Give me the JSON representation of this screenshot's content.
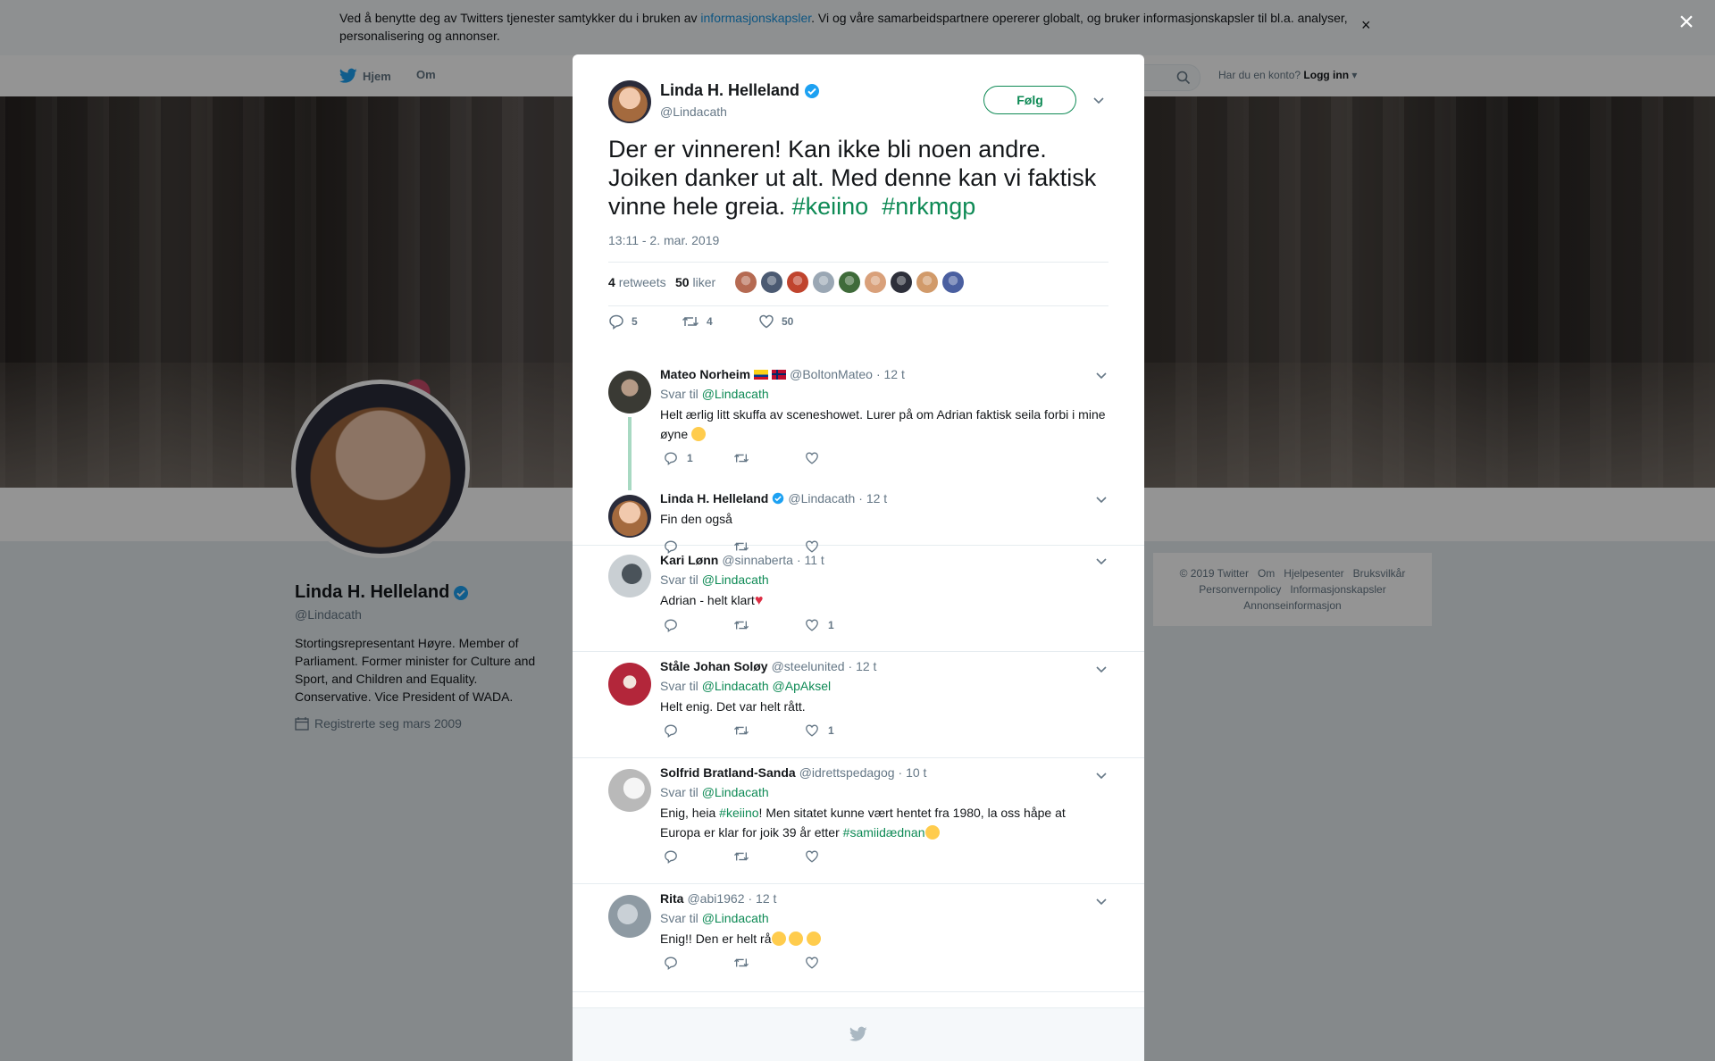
{
  "cookie": {
    "text_before": "Ved å benytte deg av Twitters tjenester samtykker du i bruken av ",
    "link": "informasjonskapsler",
    "text_after": ". Vi og våre samarbeidspartnere opererer globalt, og bruker informasjonskapsler til bl.a. analyser, personalisering og annonser.",
    "close": "×"
  },
  "nav": {
    "home": "Hjem",
    "about": "Om",
    "login_prompt": "Har du en konto?",
    "login": "Logg inn"
  },
  "page_close": "×",
  "profile": {
    "name": "Linda H. Helleland",
    "handle": "@Lindacath",
    "bio": "Stortingsrepresentant Høyre. Member of Parliament. Former minister for Culture and Sport, and Children and Equality. Conservative. Vice President of WADA.",
    "joined": "Registrerte seg mars 2009"
  },
  "footer": {
    "copyright": "© 2019 Twitter",
    "links": [
      "Om",
      "Hjelpesenter",
      "Bruksvilkår",
      "Personvernpolicy",
      "Informasjonskapsler",
      "Annonseinformasjon"
    ]
  },
  "tweet": {
    "name": "Linda H. Helleland",
    "handle": "@Lindacath",
    "follow": "Følg",
    "text": "Der er vinneren! Kan ikke bli noen andre. Joiken danker ut alt. Med denne kan vi faktisk vinne hele greia. ",
    "hashtag1": "#keiino",
    "hashtag2": "#nrkmgp",
    "time": "13:11 - 2. mar. 2019",
    "retweets_count": "4",
    "retweets_label": "retweets",
    "likes_count": "50",
    "likes_label": "liker",
    "action_replies": "5",
    "action_retweets": "4",
    "action_likes": "50",
    "liker_colors": [
      "#b56a52",
      "#4b5a72",
      "#c0442e",
      "#9aa7b4",
      "#3f6b3a",
      "#d9a07a",
      "#2d2f3a",
      "#d19a6a",
      "#4a5fa0"
    ]
  },
  "replies": [
    {
      "name": "Mateo Norheim",
      "handle": "@BoltonMateo",
      "time": "· 12 t",
      "reply_to": "Svar til",
      "to": "@Lindacath",
      "text": "Helt ærlig litt skuffa av sceneshowet. Lurer på om Adrian faktisk seila forbi i mine øyne",
      "replies": "1",
      "retweets": "",
      "likes": "",
      "avatar": "#3a3a34"
    },
    {
      "name": "Linda H. Helleland",
      "handle": "@Lindacath",
      "time": "· 12 t",
      "text": "Fin den også",
      "replies": "",
      "retweets": "",
      "likes": ""
    },
    {
      "name": "Kari Lønn",
      "handle": "@sinnaberta",
      "time": "· 11 t",
      "reply_to": "Svar til",
      "to": "@Lindacath",
      "text": "Adrian - helt klart",
      "replies": "",
      "retweets": "",
      "likes": "1",
      "avatar": "#7c8a94"
    },
    {
      "name": "Ståle Johan Soløy",
      "handle": "@steelunited",
      "time": "· 12 t",
      "reply_to": "Svar til",
      "to": "@Lindacath",
      "to2": "@ApAksel",
      "text": "Helt enig. Det var helt rått.",
      "replies": "",
      "retweets": "",
      "likes": "1",
      "avatar": "#b3263a"
    },
    {
      "name": "Solfrid Bratland-Sanda",
      "handle": "@idrettspedagog",
      "time": "· 10 t",
      "reply_to": "Svar til",
      "to": "@Lindacath",
      "text_a": "Enig, heia ",
      "tag_a": "#keiino",
      "text_b": "! Men sitatet kunne vært hentet fra 1980, la oss håpe at Europa er klar for joik 39 år etter ",
      "tag_b": "#samiidædnan",
      "replies": "",
      "retweets": "",
      "likes": "",
      "avatar": "#d6d6d6"
    },
    {
      "name": "Rita",
      "handle": "@abi1962",
      "time": "· 12 t",
      "reply_to": "Svar til",
      "to": "@Lindacath",
      "text": "Enig!! Den er helt rå",
      "replies": "",
      "retweets": "",
      "likes": "",
      "avatar": "#8e9aa3"
    }
  ],
  "colors": {
    "accent_green": "#0e8a55",
    "verified_blue": "#1da1f2",
    "overlay": "rgba(0,0,0,0.42)"
  }
}
